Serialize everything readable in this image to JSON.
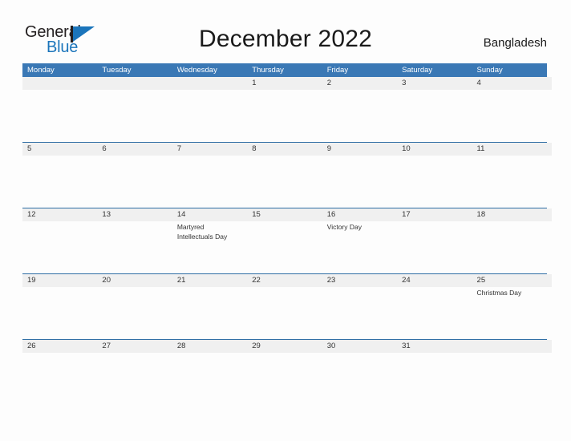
{
  "logo": {
    "text_general": "General",
    "text_blue": "Blue",
    "accent_color": "#1b75bb"
  },
  "header": {
    "title": "December 2022",
    "country": "Bangladesh"
  },
  "theme": {
    "weekday_header_bg": "#3a78b5",
    "week_strip_bg": "#f0f0f0",
    "row_rule": "#2e6da4",
    "page_bg": "#fdfdfd",
    "text": "#333333"
  },
  "calendar": {
    "weekdays": [
      "Monday",
      "Tuesday",
      "Wednesday",
      "Thursday",
      "Friday",
      "Saturday",
      "Sunday"
    ],
    "weeks": [
      [
        {
          "day": "",
          "events": []
        },
        {
          "day": "",
          "events": []
        },
        {
          "day": "",
          "events": []
        },
        {
          "day": "1",
          "events": []
        },
        {
          "day": "2",
          "events": []
        },
        {
          "day": "3",
          "events": []
        },
        {
          "day": "4",
          "events": []
        }
      ],
      [
        {
          "day": "5",
          "events": []
        },
        {
          "day": "6",
          "events": []
        },
        {
          "day": "7",
          "events": []
        },
        {
          "day": "8",
          "events": []
        },
        {
          "day": "9",
          "events": []
        },
        {
          "day": "10",
          "events": []
        },
        {
          "day": "11",
          "events": []
        }
      ],
      [
        {
          "day": "12",
          "events": []
        },
        {
          "day": "13",
          "events": []
        },
        {
          "day": "14",
          "events": [
            "Martyred",
            "Intellectuals Day"
          ]
        },
        {
          "day": "15",
          "events": []
        },
        {
          "day": "16",
          "events": [
            "Victory Day"
          ]
        },
        {
          "day": "17",
          "events": []
        },
        {
          "day": "18",
          "events": []
        }
      ],
      [
        {
          "day": "19",
          "events": []
        },
        {
          "day": "20",
          "events": []
        },
        {
          "day": "21",
          "events": []
        },
        {
          "day": "22",
          "events": []
        },
        {
          "day": "23",
          "events": []
        },
        {
          "day": "24",
          "events": []
        },
        {
          "day": "25",
          "events": [
            "Christmas Day"
          ]
        }
      ],
      [
        {
          "day": "26",
          "events": []
        },
        {
          "day": "27",
          "events": []
        },
        {
          "day": "28",
          "events": []
        },
        {
          "day": "29",
          "events": []
        },
        {
          "day": "30",
          "events": []
        },
        {
          "day": "31",
          "events": []
        },
        {
          "day": "",
          "events": []
        }
      ]
    ]
  }
}
